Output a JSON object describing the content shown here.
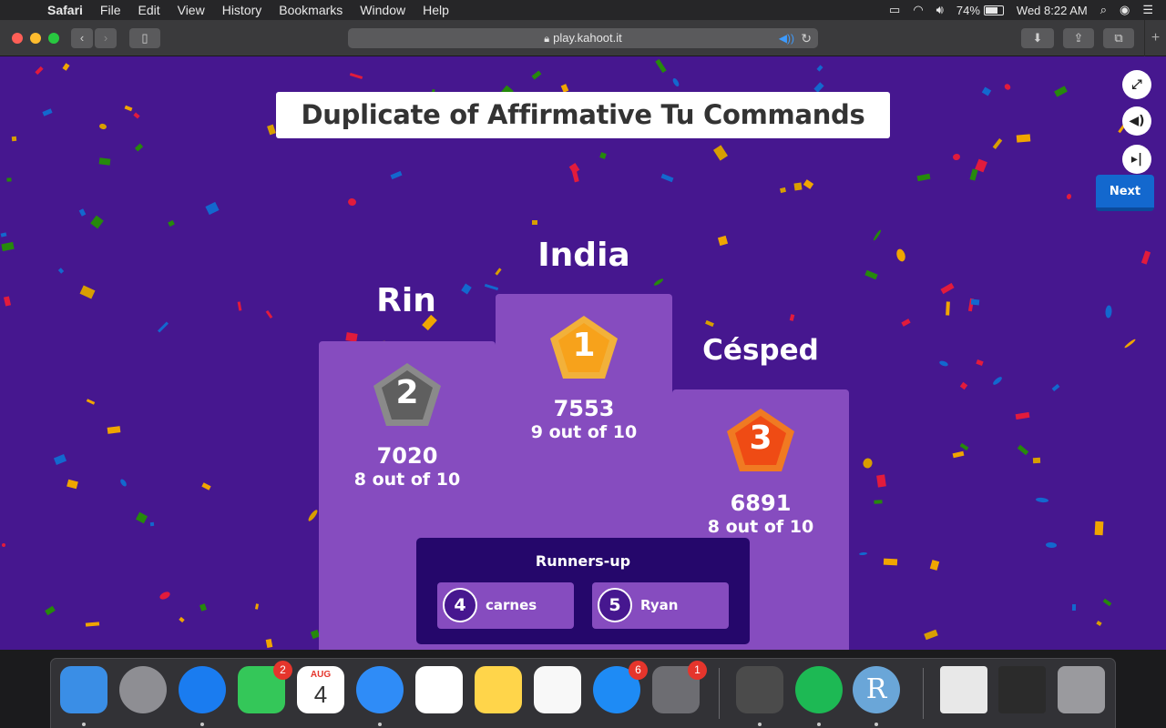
{
  "menubar": {
    "app": "Safari",
    "items": [
      "File",
      "Edit",
      "View",
      "History",
      "Bookmarks",
      "Window",
      "Help"
    ],
    "battery": "74%",
    "battery_level": 0.74,
    "clock": "Wed 8:22 AM"
  },
  "browser": {
    "url": "play.kahoot.it"
  },
  "game": {
    "title": "Duplicate of Affirmative Tu Commands",
    "next_label": "Next",
    "podium": {
      "first": {
        "name": "India",
        "rank": "1",
        "score": "7553",
        "correct": "9 out of 10"
      },
      "second": {
        "name": "Rin",
        "rank": "2",
        "score": "7020",
        "correct": "8 out of 10"
      },
      "third": {
        "name": "Césped",
        "rank": "3",
        "score": "6891",
        "correct": "8 out of 10"
      }
    },
    "runners_up": {
      "title": "Runners-up",
      "players": [
        {
          "rank": "4",
          "name": "carnes"
        },
        {
          "rank": "5",
          "name": "Ryan"
        }
      ]
    }
  },
  "dock": {
    "apps": [
      {
        "name": "Finder",
        "color": "#3a8ee6"
      },
      {
        "name": "Launchpad",
        "color": "#8e8e93"
      },
      {
        "name": "Safari",
        "color": "#1a7cf0"
      },
      {
        "name": "FaceTime",
        "color": "#34c759",
        "badge": "2"
      },
      {
        "name": "Calendar",
        "color": "#ffffff",
        "month": "AUG",
        "day": "4"
      },
      {
        "name": "Messages",
        "color": "#2f8cf7"
      },
      {
        "name": "Reminders",
        "color": "#ffffff"
      },
      {
        "name": "Notes",
        "color": "#ffd54a"
      },
      {
        "name": "News",
        "color": "#f8f8f8"
      },
      {
        "name": "App Store",
        "color": "#1e8bf5",
        "badge": "6"
      },
      {
        "name": "System Preferences",
        "color": "#6d6d72",
        "badge": "1"
      },
      {
        "name": "Sublime Text",
        "color": "#4b4b4b"
      },
      {
        "name": "Spotify",
        "color": "#1db954"
      },
      {
        "name": "R",
        "color": "#6aa6d8",
        "letter": "R"
      },
      {
        "name": "Preview",
        "color": "#e8e8e8"
      },
      {
        "name": "Terminal",
        "color": "#2b2b2b"
      },
      {
        "name": "Trash",
        "color": "#9a9a9e"
      }
    ]
  }
}
